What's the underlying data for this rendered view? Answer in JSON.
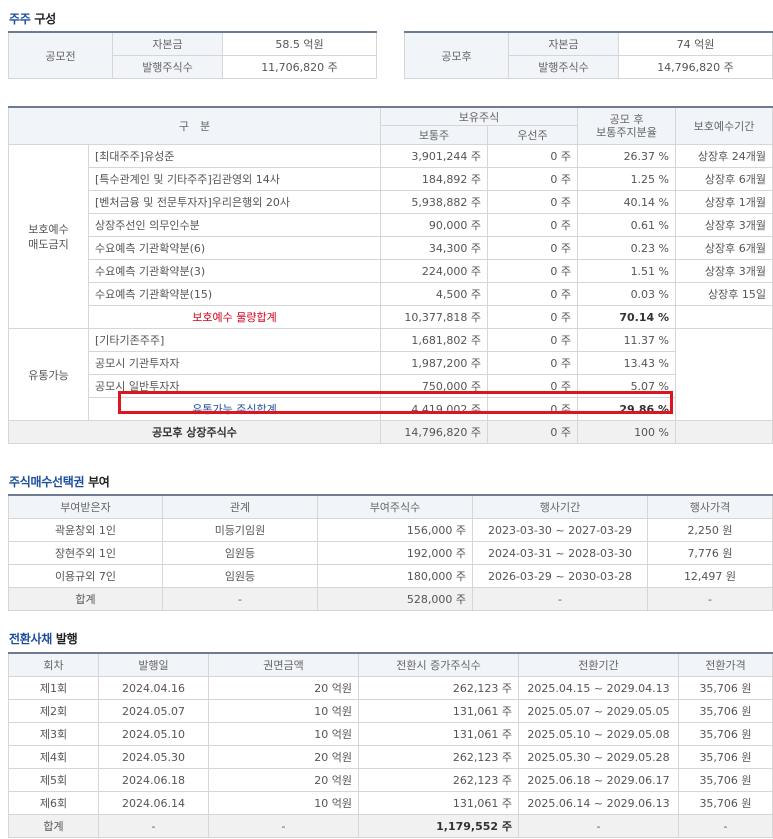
{
  "shareholder": {
    "title_hl": "주주",
    "title_rest": " 구성",
    "before": {
      "label": "공모전",
      "rows": [
        {
          "k": "자본금",
          "v": "58.5 억원"
        },
        {
          "k": "발행주식수",
          "v": "11,706,820 주"
        }
      ]
    },
    "after": {
      "label": "공모후",
      "rows": [
        {
          "k": "자본금",
          "v": "74 억원"
        },
        {
          "k": "발행주식수",
          "v": "14,796,820 주"
        }
      ]
    }
  },
  "holdings": {
    "headers": {
      "category": "구　분",
      "held": "보유주식",
      "common": "보통주",
      "preferred": "우선주",
      "ratio_l1": "공모 후",
      "ratio_l2": "보통주지분율",
      "lockup": "보호예수기간"
    },
    "group1_label_l1": "보호예수",
    "group1_label_l2": "매도금지",
    "group1": [
      {
        "name": "[최대주주]유성준",
        "common": "3,901,244 주",
        "pref": "0 주",
        "ratio": "26.37 %",
        "period": "상장후 24개월"
      },
      {
        "name": "[특수관계인 및 기타주주]김관영외 14사",
        "common": "184,892 주",
        "pref": "0 주",
        "ratio": "1.25 %",
        "period": "상장후 6개월"
      },
      {
        "name": "[벤처금융 및 전문투자자]우리은행외 20사",
        "common": "5,938,882 주",
        "pref": "0 주",
        "ratio": "40.14 %",
        "period": "상장후 1개월"
      },
      {
        "name": "상장주선인 의무인수분",
        "common": "90,000 주",
        "pref": "0 주",
        "ratio": "0.61 %",
        "period": "상장후 3개월"
      },
      {
        "name": "수요예측 기관확약분(6)",
        "common": "34,300 주",
        "pref": "0 주",
        "ratio": "0.23 %",
        "period": "상장후 6개월"
      },
      {
        "name": "수요예측 기관확약분(3)",
        "common": "224,000 주",
        "pref": "0 주",
        "ratio": "1.51 %",
        "period": "상장후 3개월"
      },
      {
        "name": "수요예측 기관확약분(15)",
        "common": "4,500 주",
        "pref": "0 주",
        "ratio": "0.03 %",
        "period": "상장후 15일"
      }
    ],
    "group1_total": {
      "name": "보호예수 물량합계",
      "common": "10,377,818 주",
      "pref": "0 주",
      "ratio": "70.14 %"
    },
    "group2_label": "유통가능",
    "group2": [
      {
        "name": "[기타기존주주]",
        "common": "1,681,802 주",
        "pref": "0 주",
        "ratio": "11.37 %"
      },
      {
        "name": "공모시 기관투자자",
        "common": "1,987,200 주",
        "pref": "0 주",
        "ratio": "13.43 %"
      },
      {
        "name": "공모시 일반투자자",
        "common": "750,000 주",
        "pref": "0 주",
        "ratio": "5.07 %"
      }
    ],
    "group2_total": {
      "name": "유통가능 주식합계",
      "common": "4,419,002 주",
      "pref": "0 주",
      "ratio": "29.86 %"
    },
    "grand_total": {
      "name": "공모후 상장주식수",
      "common": "14,796,820 주",
      "pref": "0 주",
      "ratio": "100 %"
    }
  },
  "options": {
    "title_hl": "주식매수선택권",
    "title_rest": " 부여",
    "headers": [
      "부여받은자",
      "관계",
      "부여주식수",
      "행사기간",
      "행사가격"
    ],
    "rows": [
      [
        "곽윤창외 1인",
        "미등기임원",
        "156,000 주",
        "2023-03-30 ~ 2027-03-29",
        "2,250 원"
      ],
      [
        "장현주외 1인",
        "임원등",
        "192,000 주",
        "2024-03-31 ~ 2028-03-30",
        "7,776 원"
      ],
      [
        "이용규외 7인",
        "임원등",
        "180,000 주",
        "2026-03-29 ~ 2030-03-28",
        "12,497 원"
      ]
    ],
    "total": [
      "합계",
      "-",
      "528,000 주",
      "-",
      "-"
    ]
  },
  "bonds": {
    "title_hl": "전환사채",
    "title_rest": " 발행",
    "headers": [
      "회차",
      "발행일",
      "권면금액",
      "전환시 증가주식수",
      "전환기간",
      "전환가격"
    ],
    "rows": [
      [
        "제1회",
        "2024.04.16",
        "20 억원",
        "262,123 주",
        "2025.04.15 ~ 2029.04.13",
        "35,706 원"
      ],
      [
        "제2회",
        "2024.05.07",
        "10 억원",
        "131,061 주",
        "2025.05.07 ~ 2029.05.05",
        "35,706 원"
      ],
      [
        "제3회",
        "2024.05.10",
        "10 억원",
        "131,061 주",
        "2025.05.10 ~ 2029.05.08",
        "35,706 원"
      ],
      [
        "제4회",
        "2024.05.30",
        "20 억원",
        "262,123 주",
        "2025.05.30 ~ 2029.05.28",
        "35,706 원"
      ],
      [
        "제5회",
        "2024.06.18",
        "20 억원",
        "262,123 주",
        "2025.06.18 ~ 2029.06.17",
        "35,706 원"
      ],
      [
        "제6회",
        "2024.06.14",
        "10 억원",
        "131,061 주",
        "2025.06.14 ~ 2029.06.13",
        "35,706 원"
      ]
    ],
    "total": [
      "합계",
      "-",
      "-",
      "1,179,552 주",
      "-",
      "-"
    ]
  }
}
